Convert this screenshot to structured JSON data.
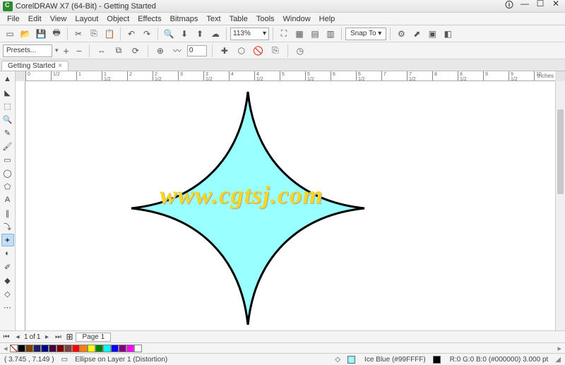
{
  "title": "CorelDRAW X7 (64-Bit) - Getting Started",
  "menus": [
    "File",
    "Edit",
    "View",
    "Layout",
    "Object",
    "Effects",
    "Bitmaps",
    "Text",
    "Table",
    "Tools",
    "Window",
    "Help"
  ],
  "zoom": "113%",
  "snap": "Snap To",
  "propbar": {
    "preset": "Presets...",
    "amp_val": "0"
  },
  "doc_tab": "Getting Started",
  "ruler_unit": "inches",
  "ruler_ticks": [
    "0",
    "1/2",
    "1",
    "1 1/2",
    "2",
    "2 1/2",
    "3",
    "3 1/2",
    "4",
    "4 1/2",
    "5",
    "5 1/2",
    "6",
    "6 1/2",
    "7",
    "7 1/2",
    "8",
    "8 1/2",
    "9",
    "9 1/2",
    "10"
  ],
  "watermark": "www.cgtsj.com",
  "page": {
    "current": "1",
    "total": "1",
    "label": "Page 1"
  },
  "palette": [
    "#000000",
    "#804000",
    "#202060",
    "#000080",
    "#400040",
    "#800000",
    "#804040",
    "#ff0000",
    "#ff8000",
    "#ffff00",
    "#008000",
    "#00ffff",
    "#0000ff",
    "#800080",
    "#ff00ff",
    "#ffffff"
  ],
  "status": {
    "coords": "( 3.745 , 7.149 )",
    "obj": "Ellipse on Layer 1 (Distortion)",
    "fill_color": "#99ffff",
    "fill_label": "Ice Blue (#99FFFF)",
    "outline_color": "#000000",
    "outline_label": "R:0 G:0 B:0 (#000000) 3.000 pt"
  }
}
